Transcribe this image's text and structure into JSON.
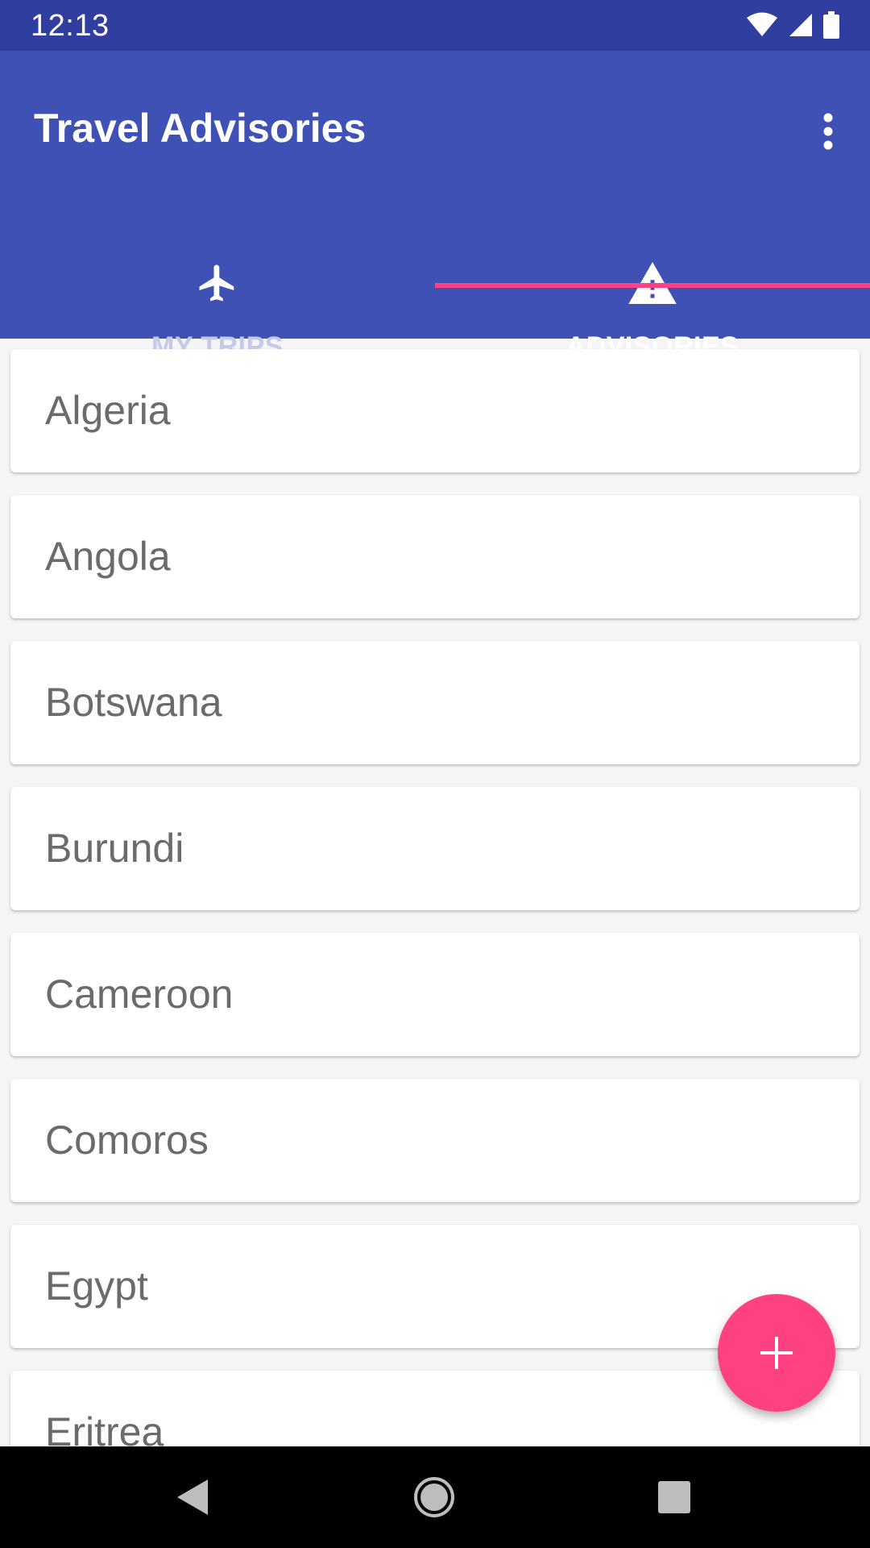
{
  "status_bar": {
    "time": "12:13",
    "icons": [
      "wifi-icon",
      "signal-icon",
      "battery-icon"
    ]
  },
  "app_bar": {
    "title": "Travel Advisories",
    "overflow_icon": "more-vert-icon"
  },
  "tabs": [
    {
      "label": "MY TRIPS",
      "icon": "airplane-icon",
      "selected": false
    },
    {
      "label": "ADVISORIES",
      "icon": "warning-icon",
      "selected": true
    }
  ],
  "advisories": [
    {
      "country": "Algeria"
    },
    {
      "country": "Angola"
    },
    {
      "country": "Botswana"
    },
    {
      "country": "Burundi"
    },
    {
      "country": "Cameroon"
    },
    {
      "country": "Comoros"
    },
    {
      "country": "Egypt"
    },
    {
      "country": "Eritrea"
    }
  ],
  "fab": {
    "icon": "add-icon"
  },
  "nav_bar": {
    "buttons": [
      "back-icon",
      "home-icon",
      "recents-icon"
    ]
  },
  "colors": {
    "primary": "#3f51b5",
    "primary_dark": "#303f9f",
    "accent": "#ff4081"
  }
}
